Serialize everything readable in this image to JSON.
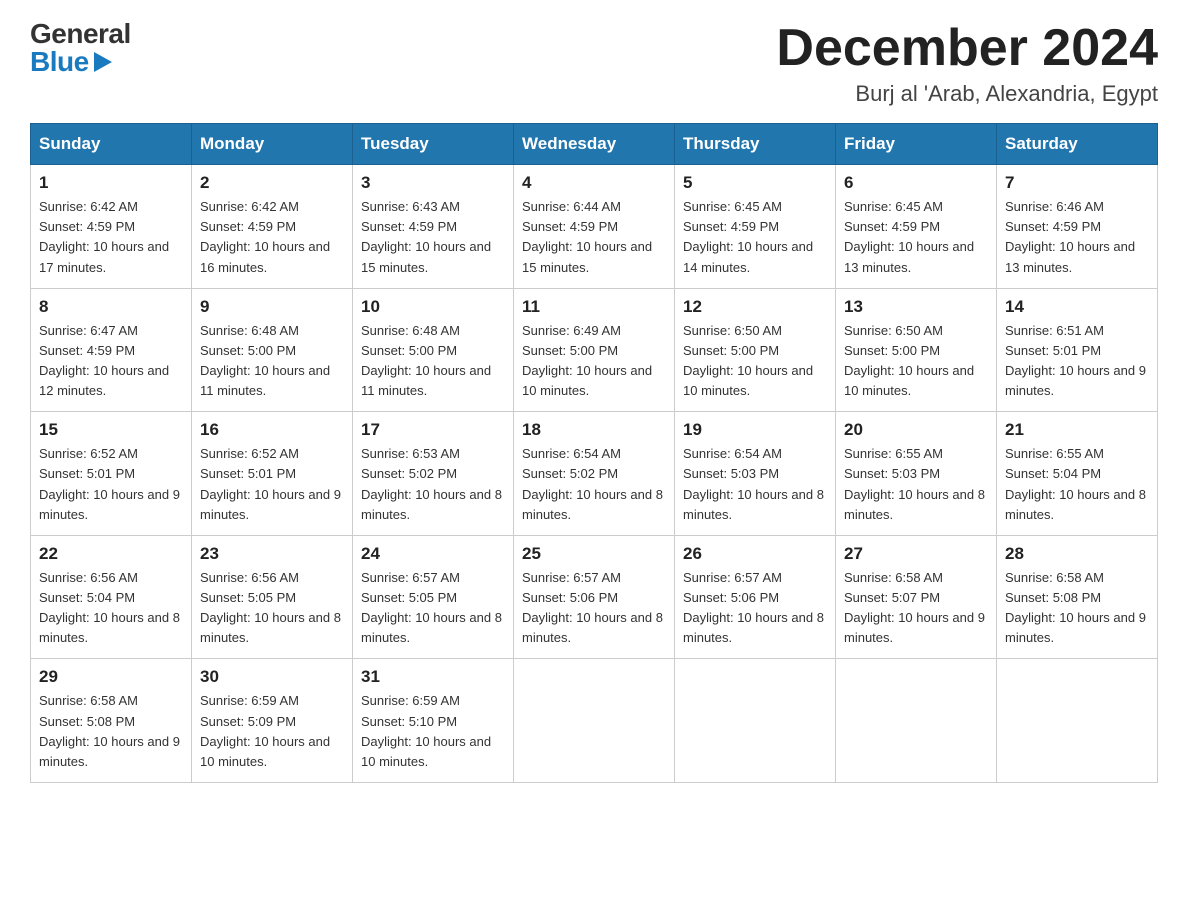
{
  "header": {
    "logo_general": "General",
    "logo_blue": "Blue",
    "month_title": "December 2024",
    "location": "Burj al 'Arab, Alexandria, Egypt"
  },
  "days_of_week": [
    "Sunday",
    "Monday",
    "Tuesday",
    "Wednesday",
    "Thursday",
    "Friday",
    "Saturday"
  ],
  "weeks": [
    [
      {
        "day": "1",
        "sunrise": "6:42 AM",
        "sunset": "4:59 PM",
        "daylight": "10 hours and 17 minutes."
      },
      {
        "day": "2",
        "sunrise": "6:42 AM",
        "sunset": "4:59 PM",
        "daylight": "10 hours and 16 minutes."
      },
      {
        "day": "3",
        "sunrise": "6:43 AM",
        "sunset": "4:59 PM",
        "daylight": "10 hours and 15 minutes."
      },
      {
        "day": "4",
        "sunrise": "6:44 AM",
        "sunset": "4:59 PM",
        "daylight": "10 hours and 15 minutes."
      },
      {
        "day": "5",
        "sunrise": "6:45 AM",
        "sunset": "4:59 PM",
        "daylight": "10 hours and 14 minutes."
      },
      {
        "day": "6",
        "sunrise": "6:45 AM",
        "sunset": "4:59 PM",
        "daylight": "10 hours and 13 minutes."
      },
      {
        "day": "7",
        "sunrise": "6:46 AM",
        "sunset": "4:59 PM",
        "daylight": "10 hours and 13 minutes."
      }
    ],
    [
      {
        "day": "8",
        "sunrise": "6:47 AM",
        "sunset": "4:59 PM",
        "daylight": "10 hours and 12 minutes."
      },
      {
        "day": "9",
        "sunrise": "6:48 AM",
        "sunset": "5:00 PM",
        "daylight": "10 hours and 11 minutes."
      },
      {
        "day": "10",
        "sunrise": "6:48 AM",
        "sunset": "5:00 PM",
        "daylight": "10 hours and 11 minutes."
      },
      {
        "day": "11",
        "sunrise": "6:49 AM",
        "sunset": "5:00 PM",
        "daylight": "10 hours and 10 minutes."
      },
      {
        "day": "12",
        "sunrise": "6:50 AM",
        "sunset": "5:00 PM",
        "daylight": "10 hours and 10 minutes."
      },
      {
        "day": "13",
        "sunrise": "6:50 AM",
        "sunset": "5:00 PM",
        "daylight": "10 hours and 10 minutes."
      },
      {
        "day": "14",
        "sunrise": "6:51 AM",
        "sunset": "5:01 PM",
        "daylight": "10 hours and 9 minutes."
      }
    ],
    [
      {
        "day": "15",
        "sunrise": "6:52 AM",
        "sunset": "5:01 PM",
        "daylight": "10 hours and 9 minutes."
      },
      {
        "day": "16",
        "sunrise": "6:52 AM",
        "sunset": "5:01 PM",
        "daylight": "10 hours and 9 minutes."
      },
      {
        "day": "17",
        "sunrise": "6:53 AM",
        "sunset": "5:02 PM",
        "daylight": "10 hours and 8 minutes."
      },
      {
        "day": "18",
        "sunrise": "6:54 AM",
        "sunset": "5:02 PM",
        "daylight": "10 hours and 8 minutes."
      },
      {
        "day": "19",
        "sunrise": "6:54 AM",
        "sunset": "5:03 PM",
        "daylight": "10 hours and 8 minutes."
      },
      {
        "day": "20",
        "sunrise": "6:55 AM",
        "sunset": "5:03 PM",
        "daylight": "10 hours and 8 minutes."
      },
      {
        "day": "21",
        "sunrise": "6:55 AM",
        "sunset": "5:04 PM",
        "daylight": "10 hours and 8 minutes."
      }
    ],
    [
      {
        "day": "22",
        "sunrise": "6:56 AM",
        "sunset": "5:04 PM",
        "daylight": "10 hours and 8 minutes."
      },
      {
        "day": "23",
        "sunrise": "6:56 AM",
        "sunset": "5:05 PM",
        "daylight": "10 hours and 8 minutes."
      },
      {
        "day": "24",
        "sunrise": "6:57 AM",
        "sunset": "5:05 PM",
        "daylight": "10 hours and 8 minutes."
      },
      {
        "day": "25",
        "sunrise": "6:57 AM",
        "sunset": "5:06 PM",
        "daylight": "10 hours and 8 minutes."
      },
      {
        "day": "26",
        "sunrise": "6:57 AM",
        "sunset": "5:06 PM",
        "daylight": "10 hours and 8 minutes."
      },
      {
        "day": "27",
        "sunrise": "6:58 AM",
        "sunset": "5:07 PM",
        "daylight": "10 hours and 9 minutes."
      },
      {
        "day": "28",
        "sunrise": "6:58 AM",
        "sunset": "5:08 PM",
        "daylight": "10 hours and 9 minutes."
      }
    ],
    [
      {
        "day": "29",
        "sunrise": "6:58 AM",
        "sunset": "5:08 PM",
        "daylight": "10 hours and 9 minutes."
      },
      {
        "day": "30",
        "sunrise": "6:59 AM",
        "sunset": "5:09 PM",
        "daylight": "10 hours and 10 minutes."
      },
      {
        "day": "31",
        "sunrise": "6:59 AM",
        "sunset": "5:10 PM",
        "daylight": "10 hours and 10 minutes."
      },
      null,
      null,
      null,
      null
    ]
  ]
}
